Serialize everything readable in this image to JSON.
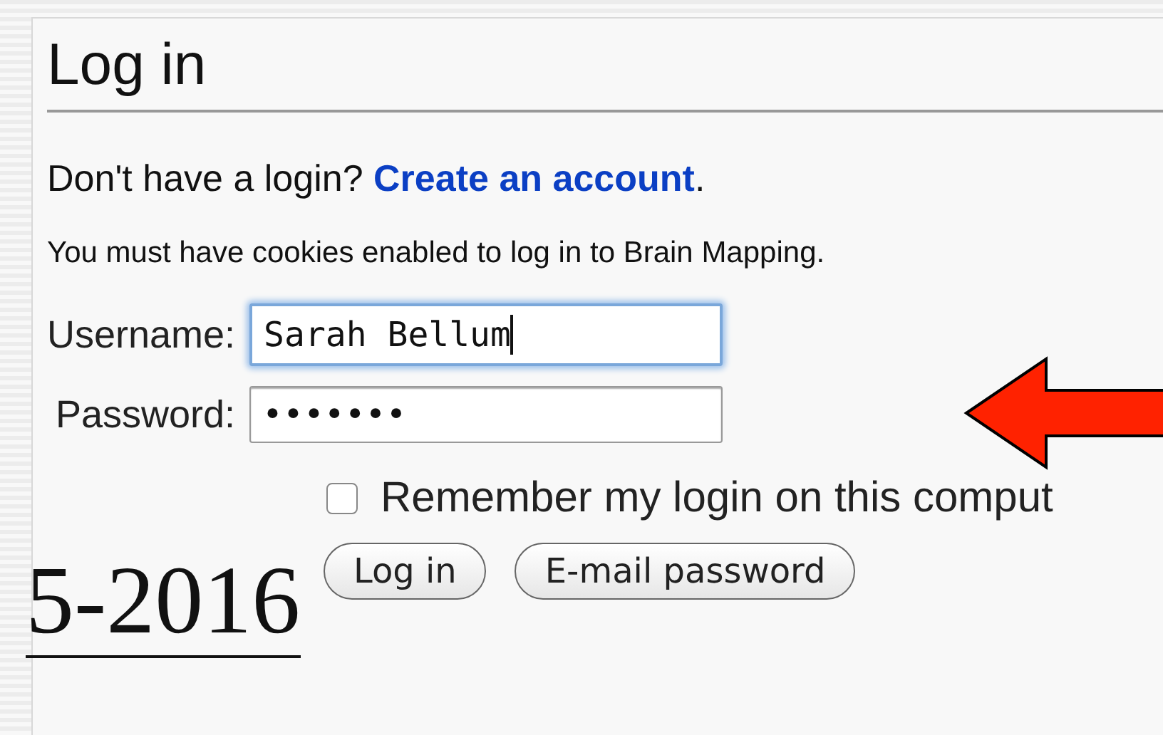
{
  "title": "Log in",
  "signup_prompt": {
    "text": "Don't have a login?",
    "link": "Create an account",
    "trailing": "."
  },
  "cookie_notice": "You must have cookies enabled to log in to Brain Mapping.",
  "fields": [
    {
      "label": "Username:",
      "value": "Sarah Bellum",
      "focused": true
    },
    {
      "label": "Password:",
      "value": "•••••••",
      "focused": false
    }
  ],
  "remember": {
    "label": "Remember my login on this comput",
    "checked": false
  },
  "buttons": [
    "Log in",
    "E-mail password"
  ],
  "slide_date": "5-2016"
}
